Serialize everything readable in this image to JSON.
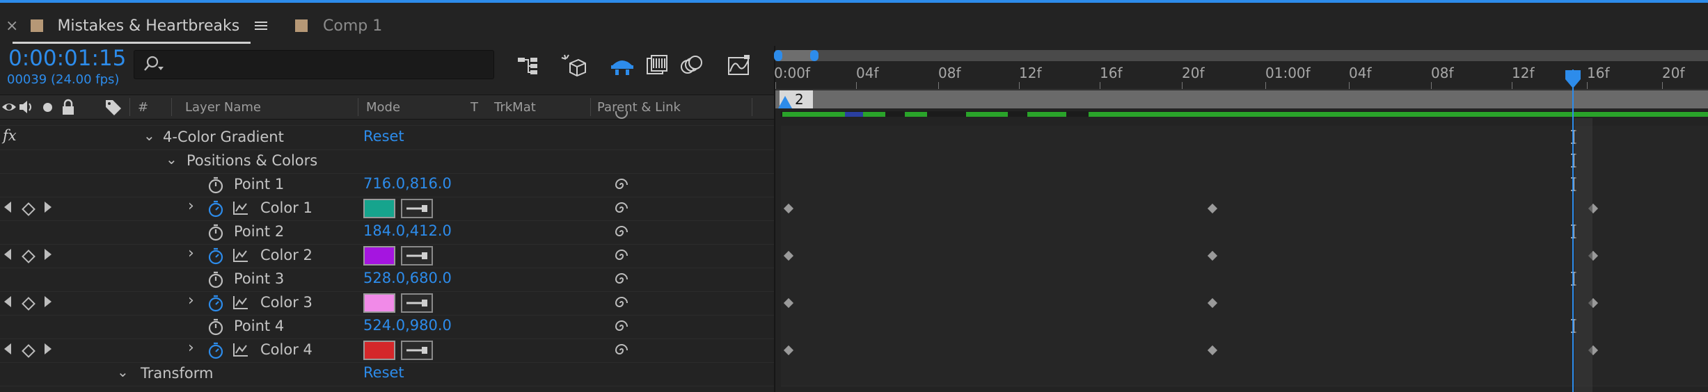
{
  "tabs": [
    {
      "title": "Mistakes & Heartbreaks",
      "active": true
    },
    {
      "title": "Comp 1",
      "active": false
    }
  ],
  "timecode": "0:00:01:15",
  "frame_info": "00039 (24.00 fps)",
  "search": {
    "placeholder": ""
  },
  "columns": {
    "layer_name": "Layer Name",
    "mode": "Mode",
    "t": "T",
    "trkmat": "TrkMat",
    "parent_link": "Parent & Link",
    "number": "#"
  },
  "ruler_labels": [
    "0:00f",
    "04f",
    "08f",
    "12f",
    "16f",
    "20f",
    "01:00f",
    "04f",
    "08f",
    "12f",
    "16f",
    "20f"
  ],
  "work_area_label": "2",
  "rows": [
    {
      "kind": "effect",
      "label": "4-Color Gradient",
      "value": "Reset",
      "fx": "fx"
    },
    {
      "kind": "group",
      "label": "Positions & Colors"
    },
    {
      "kind": "point",
      "label": "Point 1",
      "value": "716.0,816.0"
    },
    {
      "kind": "color",
      "label": "Color 1",
      "color": "#16a48d"
    },
    {
      "kind": "point",
      "label": "Point 2",
      "value": "184.0,412.0"
    },
    {
      "kind": "color",
      "label": "Color 2",
      "color": "#a515e0"
    },
    {
      "kind": "point",
      "label": "Point 3",
      "value": "528.0,680.0"
    },
    {
      "kind": "color",
      "label": "Color 3",
      "color": "#f18ae8"
    },
    {
      "kind": "point",
      "label": "Point 4",
      "value": "524.0,980.0"
    },
    {
      "kind": "color",
      "label": "Color 4",
      "color": "#d4272a"
    },
    {
      "kind": "transform",
      "label": "Transform",
      "value": "Reset"
    }
  ],
  "colors": {
    "accent": "#2d8ceb",
    "bar_green": "#2aa32a",
    "bar_blue": "#2a3fa0"
  }
}
